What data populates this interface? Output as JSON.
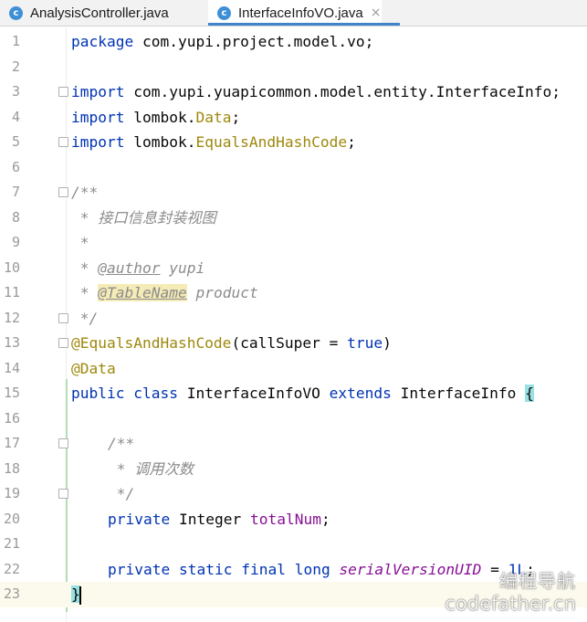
{
  "tabs": [
    {
      "label": "AnalysisController.java",
      "icon": "class-icon",
      "active": false
    },
    {
      "label": "InterfaceInfoVO.java",
      "icon": "class-icon",
      "active": true
    }
  ],
  "close_glyph": "×",
  "class_icon_letter": "c",
  "lines": [
    {
      "n": "1"
    },
    {
      "n": "2"
    },
    {
      "n": "3"
    },
    {
      "n": "4"
    },
    {
      "n": "5"
    },
    {
      "n": "6"
    },
    {
      "n": "7"
    },
    {
      "n": "8"
    },
    {
      "n": "9"
    },
    {
      "n": "10"
    },
    {
      "n": "11"
    },
    {
      "n": "12"
    },
    {
      "n": "13"
    },
    {
      "n": "14"
    },
    {
      "n": "15"
    },
    {
      "n": "16"
    },
    {
      "n": "17"
    },
    {
      "n": "18"
    },
    {
      "n": "19"
    },
    {
      "n": "20"
    },
    {
      "n": "21"
    },
    {
      "n": "22"
    },
    {
      "n": "23"
    }
  ],
  "code": {
    "l1": {
      "kw": "package",
      "rest": " com.yupi.project.model.vo;"
    },
    "l3": {
      "kw": "import",
      "rest": " com.yupi.yuapicommon.model.entity.InterfaceInfo;"
    },
    "l4": {
      "kw": "import",
      "pre": " lombok.",
      "cls": "Data",
      "post": ";"
    },
    "l5": {
      "kw": "import",
      "pre": " lombok.",
      "cls": "EqualsAndHashCode",
      "post": ";"
    },
    "l7": {
      "text": "/**"
    },
    "l8": {
      "text": " * 接口信息封装视图"
    },
    "l9": {
      "text": " *"
    },
    "l10": {
      "pre": " * ",
      "tag": "@author",
      "post": " yupi"
    },
    "l11": {
      "pre": " * ",
      "tag": "@TableName",
      "post": " product"
    },
    "l12": {
      "text": " */"
    },
    "l13": {
      "ann": "@EqualsAndHashCode",
      "pre": "(callSuper = ",
      "kw": "true",
      "post": ")"
    },
    "l14": {
      "ann": "@Data"
    },
    "l15": {
      "kw1": "public",
      "kw2": "class",
      "name": "InterfaceInfoVO",
      "kw3": "extends",
      "parent": "InterfaceInfo",
      "brace": "{"
    },
    "l17": {
      "text": "/**"
    },
    "l18": {
      "text": " * 调用次数"
    },
    "l19": {
      "text": " */"
    },
    "l20": {
      "kw": "private",
      "type": "Integer",
      "field": "totalNum",
      "post": ";"
    },
    "l22": {
      "kw1": "private",
      "kw2": "static",
      "kw3": "final",
      "kw4": "long",
      "field": "serialVersionUID",
      "eq": " = ",
      "val": "1L",
      "post": ";"
    },
    "l23": {
      "brace": "}"
    }
  },
  "watermark": {
    "line1": "编程导航",
    "line2": "codefather.cn"
  }
}
